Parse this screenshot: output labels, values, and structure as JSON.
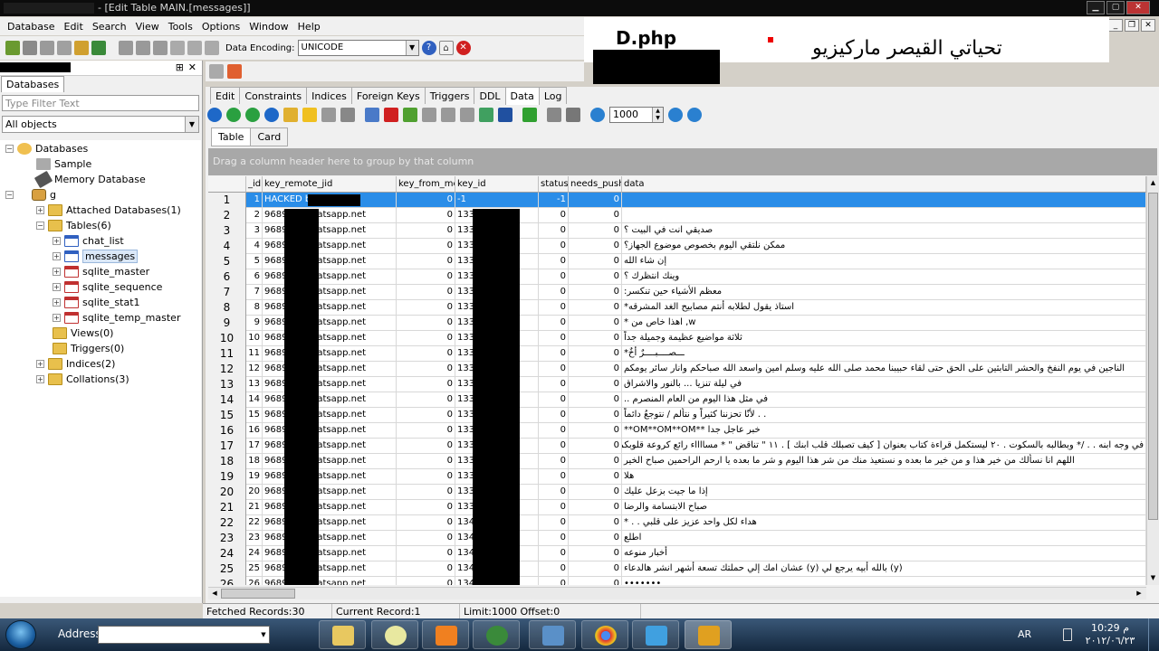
{
  "window": {
    "title": "- [Edit Table MAIN.[messages]]"
  },
  "menu": [
    "Database",
    "Edit",
    "Search",
    "View",
    "Tools",
    "Options",
    "Window",
    "Help"
  ],
  "toolbar": {
    "encoding_label": "Data Encoding:",
    "encoding_value": "UNICODE"
  },
  "overlay": {
    "dphp": "D.php",
    "arabic_title": "تحياتي القيصر ماركيزيو"
  },
  "left_panel": {
    "tab": "Databases",
    "filter_placeholder": "Type Filter Text",
    "combo_value": "All objects",
    "tree": {
      "root": "Databases",
      "sample": "Sample",
      "memory": "Memory Database",
      "g": "g",
      "attached": "Attached Databases(1)",
      "tables": "Tables(6)",
      "chat_list": "chat_list",
      "messages": "messages",
      "sqlite_master": "sqlite_master",
      "sqlite_sequence": "sqlite_sequence",
      "sqlite_stat1": "sqlite_stat1",
      "sqlite_temp_master": "sqlite_temp_master",
      "views": "Views(0)",
      "triggers": "Triggers(0)",
      "indices": "Indices(2)",
      "collations": "Collations(3)"
    }
  },
  "editor": {
    "tabs": [
      "Edit",
      "Constraints",
      "Indices",
      "Foreign Keys",
      "Triggers",
      "DDL",
      "Data",
      "Log"
    ],
    "record_limit": "1000",
    "subtabs": [
      "Table",
      "Card"
    ],
    "group_hint": "Drag a column header here to group by that column",
    "columns": [
      "_id",
      "key_remote_jid",
      "key_from_me",
      "key_id",
      "status",
      "needs_push",
      "data"
    ],
    "rows": [
      {
        "n": "1",
        "id": "1",
        "jid": "HACKED by :",
        "from": "0",
        "key": "-1",
        "status": "-1",
        "push": "0",
        "data": ""
      },
      {
        "n": "2",
        "id": "2",
        "jid": "9689@s.whatsapp.net",
        "from": "0",
        "key": "133-5",
        "status": "0",
        "push": "0",
        "data": ""
      },
      {
        "n": "3",
        "id": "3",
        "jid": "9689@s.whatsapp.net",
        "from": "0",
        "key": "133-6",
        "status": "0",
        "push": "0",
        "data": "صديقي انت في البيت ؟"
      },
      {
        "n": "4",
        "id": "4",
        "jid": "9689@s.whatsapp.net",
        "from": "0",
        "key": "133-7",
        "status": "0",
        "push": "0",
        "data": "ممكن نلتقي اليوم بخصوص موضوع الجهاز؟"
      },
      {
        "n": "5",
        "id": "5",
        "jid": "9689@s.whatsapp.net",
        "from": "0",
        "key": "133-8",
        "status": "0",
        "push": "0",
        "data": "إن شاء الله"
      },
      {
        "n": "6",
        "id": "6",
        "jid": "9689@s.whatsapp.net",
        "from": "0",
        "key": "133",
        "status": "0",
        "push": "0",
        "data": "وينك انتظرك ؟"
      },
      {
        "n": "7",
        "id": "7",
        "jid": "9689@s.whatsapp.net",
        "from": "0",
        "key": "133",
        "status": "0",
        "push": "0",
        "data": "معظم الأشياء حين تنكسر:"
      },
      {
        "n": "8",
        "id": "8",
        "jid": "9689@s.whatsapp.net",
        "from": "0",
        "key": "133",
        "status": "0",
        "push": "0",
        "data": "استاذ يقول لطلابه أنتم مصابيح الغد المشرقه*"
      },
      {
        "n": "9",
        "id": "9",
        "jid": "9689@s.whatsapp.net",
        "from": "0",
        "key": "133-8",
        "status": "0",
        "push": "0",
        "data": "w, اهذا خاص من *"
      },
      {
        "n": "10",
        "id": "10",
        "jid": "9689@s.whatsapp.net",
        "from": "0",
        "key": "133 2",
        "status": "0",
        "push": "0",
        "data": "ثلاثة مواضيع عظيمة وجميلة جداً"
      },
      {
        "n": "11",
        "id": "11",
        "jid": "9689@s.whatsapp.net",
        "from": "0",
        "key": "133",
        "status": "0",
        "push": "0",
        "data": "ـــصــــبــــرٌ أخٌ*"
      },
      {
        "n": "12",
        "id": "12",
        "jid": "9689@s.whatsapp.net",
        "from": "0",
        "key": "133",
        "status": "0",
        "push": "0",
        "data": "الناجين في يوم النفخ والحشر التابثين على الحق حتى لقاء حبيبنا محمد صلى الله عليه وسلم امين واسعد الله صباحكم وانار سائر يومكم"
      },
      {
        "n": "13",
        "id": "13",
        "jid": "9689@s.whatsapp.net",
        "from": "0",
        "key": "133 8",
        "status": "0",
        "push": "0",
        "data": "في ليلة تنزيا ... بالنور والاشراق"
      },
      {
        "n": "14",
        "id": "14",
        "jid": "9689@s.whatsapp.net",
        "from": "0",
        "key": "133",
        "status": "0",
        "push": "0",
        "data": "في مثل هذا اليوم من العام المنصرم .."
      },
      {
        "n": "15",
        "id": "15",
        "jid": "9689@s.whatsapp.net",
        "from": "0",
        "key": "133",
        "status": "0",
        "push": "0",
        "data": ". . لأنّا تحزننا كثيراً و نتألم / نتوجعُ دائماً"
      },
      {
        "n": "16",
        "id": "16",
        "jid": "9689@s.whatsapp.net",
        "from": "0",
        "key": "133 52",
        "status": "0",
        "push": "0",
        "data": "خبر عاجل جدا **OM**OM**OM**"
      },
      {
        "n": "17",
        "id": "17",
        "jid": "9689@s.whatsapp.net",
        "from": "0",
        "key": "133",
        "status": "0",
        "push": "0",
        "data": "في وجه ابنه . . /* وبطالبه بالسكوت . ٢٠ ليستكمل قراءة كتاب بعنوان [ كيف تصبلك قلب ابنك ] . ١١ \" تناقض \" * مسااااء رائع كروعة قلوبكم"
      },
      {
        "n": "18",
        "id": "18",
        "jid": "9689@s.whatsapp.net",
        "from": "0",
        "key": "133 4-1",
        "status": "0",
        "push": "0",
        "data": "اللهم انا نسألك من خير هذا و من خير ما بعده و نستعيذ منك من شر هذا اليوم و شر ما بعده يا ارحم الراحمين صباح الخير"
      },
      {
        "n": "19",
        "id": "19",
        "jid": "9689@s.whatsapp.net",
        "from": "0",
        "key": "133",
        "status": "0",
        "push": "0",
        "data": "هلا"
      },
      {
        "n": "20",
        "id": "20",
        "jid": "9689@s.whatsapp.net",
        "from": "0",
        "key": "133-53",
        "status": "0",
        "push": "0",
        "data": "إذا ما جيت بزعل عليك"
      },
      {
        "n": "21",
        "id": "21",
        "jid": "9689@s.whatsapp.net",
        "from": "0",
        "key": "133",
        "status": "0",
        "push": "0",
        "data": "صباح الابتسامة والرضا"
      },
      {
        "n": "22",
        "id": "22",
        "jid": "9689@s.whatsapp.net",
        "from": "0",
        "key": "134-54",
        "status": "0",
        "push": "0",
        "data": "هداء لكل واحد عزيز على قلبي . . *"
      },
      {
        "n": "23",
        "id": "23",
        "jid": "9689@s.whatsapp.net",
        "from": "0",
        "key": "134-35",
        "status": "0",
        "push": "0",
        "data": "اطلع"
      },
      {
        "n": "24",
        "id": "24",
        "jid": "9689@s.whatsapp.net",
        "from": "0",
        "key": "134",
        "status": "0",
        "push": "0",
        "data": "أخبار منوعه"
      },
      {
        "n": "25",
        "id": "25",
        "jid": "9689@s.whatsapp.net",
        "from": "0",
        "key": "134-55",
        "status": "0",
        "push": "0",
        "data": "(y) بالله أبيه يرجع لي (y) عشان امك إلي حملتك تسعة أشهر انشر هالدعاء"
      },
      {
        "n": "26",
        "id": "26",
        "jid": "9689@s.whatsapp.net",
        "from": "0",
        "key": "134-4",
        "status": "0",
        "push": "0",
        "data": "•••••••"
      }
    ]
  },
  "status_bar": {
    "fetched": "Fetched Records:30",
    "current": "Current Record:1",
    "limit": "Limit:1000 Offset:0"
  },
  "taskbar": {
    "address_label": "Address",
    "lang": "AR",
    "time": "10:29 م",
    "date": "٢٠١٢/٠٦/٢٣"
  }
}
